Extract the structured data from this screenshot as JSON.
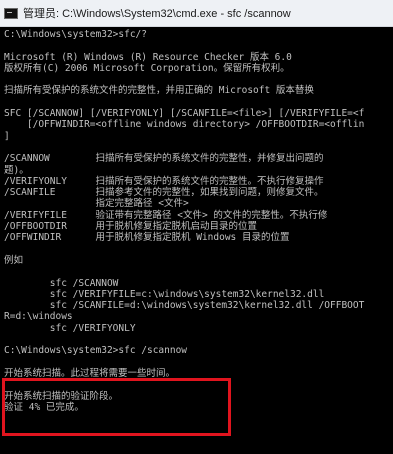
{
  "window": {
    "title": "管理员: C:\\Windows\\System32\\cmd.exe - sfc  /scannow",
    "icon": "cmd-console-icon"
  },
  "console": {
    "lines": [
      "C:\\Windows\\system32>sfc/?",
      "",
      "Microsoft (R) Windows (R) Resource Checker 版本 6.0",
      "版权所有(C) 2006 Microsoft Corporation。保留所有权利。",
      "",
      "扫描所有受保护的系统文件的完整性，并用正确的 Microsoft 版本替换",
      "",
      "SFC [/SCANNOW] [/VERIFYONLY] [/SCANFILE=<file>] [/VERIFYFILE=<f",
      "    [/OFFWINDIR=<offline windows directory> /OFFBOOTDIR=<offlin",
      "]",
      "",
      "/SCANNOW        扫描所有受保护的系统文件的完整性，并修复出问题的",
      "题)。",
      "/VERIFYONLY     扫描所有受保护的系统文件的完整性。不执行修复操作",
      "/SCANFILE       扫描参考文件的完整性，如果找到问题，则修复文件。",
      "                指定完整路径 <文件>",
      "/VERIFYFILE     验证带有完整路径 <文件> 的文件的完整性。不执行修",
      "/OFFBOOTDIR     用于脱机修复指定脱机启动目录的位置",
      "/OFFWINDIR      用于脱机修复指定脱机 Windows 目录的位置",
      "",
      "例如",
      "",
      "        sfc /SCANNOW",
      "        sfc /VERIFYFILE=c:\\windows\\system32\\kernel32.dll",
      "        sfc /SCANFILE=d:\\windows\\system32\\kernel32.dll /OFFBOOT",
      "R=d:\\windows",
      "        sfc /VERIFYONLY",
      "",
      "C:\\Windows\\system32>sfc /scannow",
      "",
      "开始系统扫描。此过程将需要一些时间。",
      "",
      "开始系统扫描的验证阶段。",
      "验证 4% 已完成。"
    ]
  }
}
